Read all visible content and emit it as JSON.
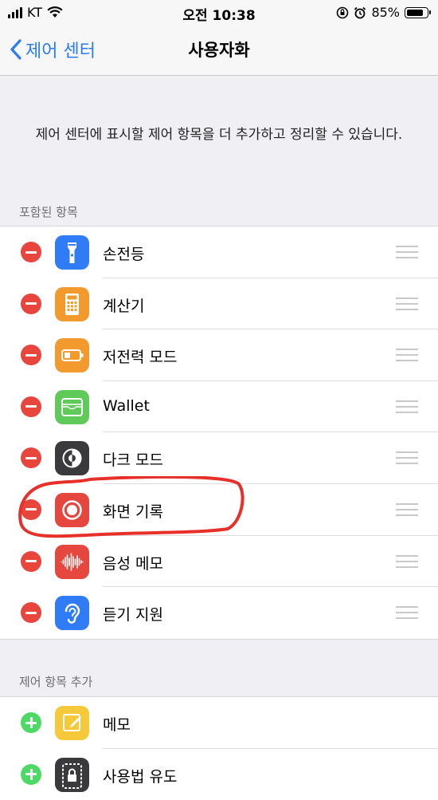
{
  "status_bar": {
    "carrier": "KT",
    "time": "오전 10:38",
    "battery_percent": "85%",
    "battery_level": 0.85,
    "icons": [
      "signal-icon",
      "wifi-icon",
      "orientation-lock-icon",
      "alarm-icon",
      "battery-icon"
    ]
  },
  "nav": {
    "back_label": "제어 센터",
    "title": "사용자화"
  },
  "description": "제어 센터에 표시할 제어 항목을 더 추가하고 정리할 수 있습니다.",
  "included": {
    "header": "포함된 항목",
    "items": [
      {
        "label": "손전등",
        "icon": "flashlight-icon",
        "color": "#2f7cf6"
      },
      {
        "label": "계산기",
        "icon": "calculator-icon",
        "color": "#f29a2e"
      },
      {
        "label": "저전력 모드",
        "icon": "battery-icon",
        "color": "#f29a2e"
      },
      {
        "label": "Wallet",
        "icon": "wallet-icon",
        "color": "#5fc95a"
      },
      {
        "label": "다크 모드",
        "icon": "dark-mode-icon",
        "color": "#3a3a3c"
      },
      {
        "label": "화면 기록",
        "icon": "screen-record-icon",
        "color": "#e5463d"
      },
      {
        "label": "음성 메모",
        "icon": "voice-memo-icon",
        "color": "#e5463d"
      },
      {
        "label": "듣기 지원",
        "icon": "ear-icon",
        "color": "#2f7cf6"
      }
    ]
  },
  "more": {
    "header": "제어 항목 추가",
    "items": [
      {
        "label": "메모",
        "icon": "notes-icon",
        "color": "#f5c93a"
      },
      {
        "label": "사용법 유도",
        "icon": "guided-access-icon",
        "color": "#3a3a3c"
      }
    ]
  },
  "colors": {
    "accent": "#2a7cf6",
    "remove": "#e8453c",
    "add": "#4cd964",
    "annotation": "#e8302a"
  }
}
